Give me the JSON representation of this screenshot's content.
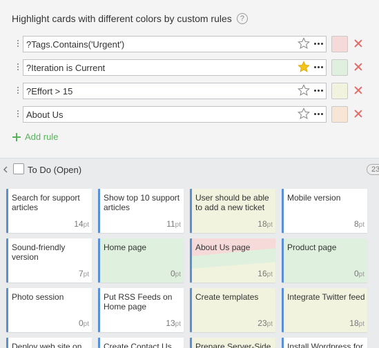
{
  "rules_panel": {
    "title": "Highlight cards with different colors by custom rules",
    "help_glyph": "?",
    "rules": [
      {
        "expression": "?Tags.Contains('Urgent')",
        "starred": false,
        "color": "#f6dada"
      },
      {
        "expression": "?Iteration is Current",
        "starred": true,
        "color": "#dff0de"
      },
      {
        "expression": "?Effort > 15",
        "starred": false,
        "color": "#f1f3de"
      },
      {
        "expression": "About Us",
        "starred": false,
        "color": "#f7e6d6"
      }
    ],
    "add_rule_label": "Add rule"
  },
  "lane": {
    "title": "To Do (Open)",
    "count": "23"
  },
  "unit_label": "pt",
  "cards": [
    {
      "title": "Search for support articles",
      "effort": "14",
      "color": "#ffffff"
    },
    {
      "title": "Show top 10 support articles",
      "effort": "11",
      "color": "#ffffff"
    },
    {
      "title": "User should be able to add a new ticket",
      "effort": "18",
      "color": "#f1f3de"
    },
    {
      "title": "Mobile version",
      "effort": "8",
      "color": "#ffffff"
    },
    {
      "title": "Sound-friendly version",
      "effort": "7",
      "color": "#ffffff"
    },
    {
      "title": "Home page",
      "effort": "0",
      "color": "#dff0de"
    },
    {
      "title": "About Us page",
      "effort": "16",
      "color": "multi"
    },
    {
      "title": "Product page",
      "effort": "0",
      "color": "#dff0de"
    },
    {
      "title": "Photo session",
      "effort": "0",
      "color": "#ffffff"
    },
    {
      "title": "Put RSS Feeds on Home page",
      "effort": "13",
      "color": "#ffffff"
    },
    {
      "title": "Create templates",
      "effort": "23",
      "color": "#f1f3de"
    },
    {
      "title": "Integrate Twitter feed",
      "effort": "18",
      "color": "#f1f3de"
    },
    {
      "title": "Deploy web site on",
      "effort": "",
      "color": "#ffffff"
    },
    {
      "title": "Create Contact Us",
      "effort": "",
      "color": "#ffffff"
    },
    {
      "title": "Prepare Server-Side",
      "effort": "",
      "color": "#f1f3de"
    },
    {
      "title": "Install Wordpress for",
      "effort": "",
      "color": "#ffffff"
    }
  ],
  "colors": {
    "accent_green": "#57b35a",
    "card_border": "#5a8fd8",
    "remove_red": "#e36a66",
    "star_gold": "#f2c318",
    "urgent": "#f6dada",
    "current": "#dff0de",
    "effort": "#f1f3de",
    "about": "#f7e6d6"
  }
}
